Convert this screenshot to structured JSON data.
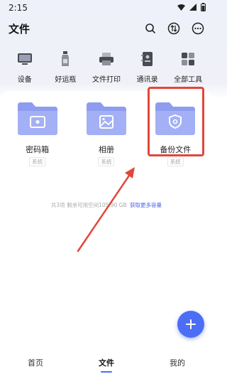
{
  "status": {
    "time": "2:15",
    "icons": [
      "wifi-icon",
      "signal-icon",
      "battery-icon"
    ]
  },
  "header": {
    "title": "文件",
    "actions": [
      "search-icon",
      "transfer-icon",
      "more-icon"
    ]
  },
  "tools": [
    {
      "label": "设备",
      "icon": "device-icon"
    },
    {
      "label": "好运瓶",
      "icon": "bottle-icon"
    },
    {
      "label": "文件打印",
      "icon": "printer-icon"
    },
    {
      "label": "通讯录",
      "icon": "contacts-icon"
    },
    {
      "label": "全部工具",
      "icon": "grid-icon"
    }
  ],
  "folders": [
    {
      "name": "密码箱",
      "tag": "系统",
      "icon": "safe-folder-icon"
    },
    {
      "name": "相册",
      "tag": "系统",
      "icon": "photo-folder-icon"
    },
    {
      "name": "备份文件",
      "tag": "系统",
      "icon": "backup-folder-icon"
    }
  ],
  "storage": {
    "text": "共3项 剩余可用空间105.90 GB",
    "link": "获取更多容量"
  },
  "fab": {
    "label": "+"
  },
  "nav": {
    "home": "首页",
    "files": "文件",
    "mine": "我的"
  },
  "colors": {
    "accent": "#4c6ef5",
    "highlight": "#e2463b"
  }
}
